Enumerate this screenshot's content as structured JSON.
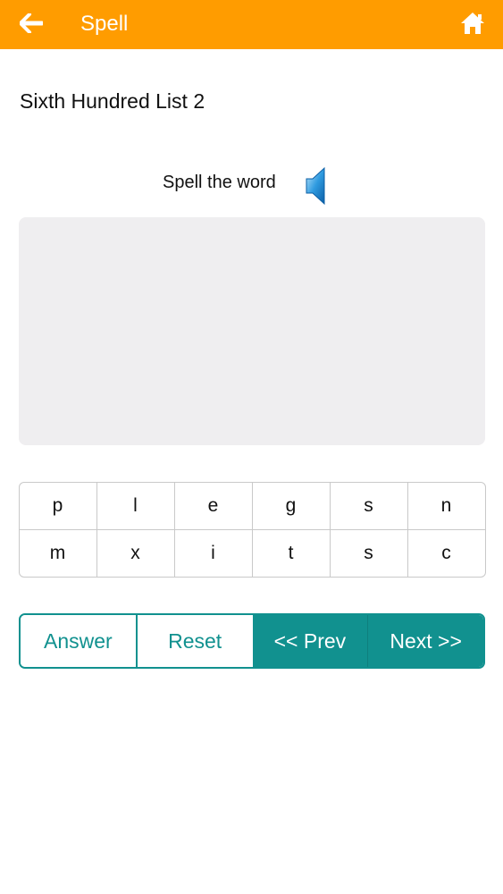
{
  "header": {
    "title": "Spell",
    "back_icon": "arrow-left-icon",
    "home_icon": "home-icon",
    "color": "#ff9c00"
  },
  "list_title": "Sixth Hundred List 2",
  "prompt": {
    "text": "Spell the word",
    "icon": "speaker-icon"
  },
  "letters": [
    [
      "p",
      "l",
      "e",
      "g",
      "s",
      "n"
    ],
    [
      "m",
      "x",
      "i",
      "t",
      "s",
      "c"
    ]
  ],
  "controls": {
    "answer": "Answer",
    "reset": "Reset",
    "prev": "<< Prev",
    "next": "Next >>",
    "accent": "#11918f"
  }
}
